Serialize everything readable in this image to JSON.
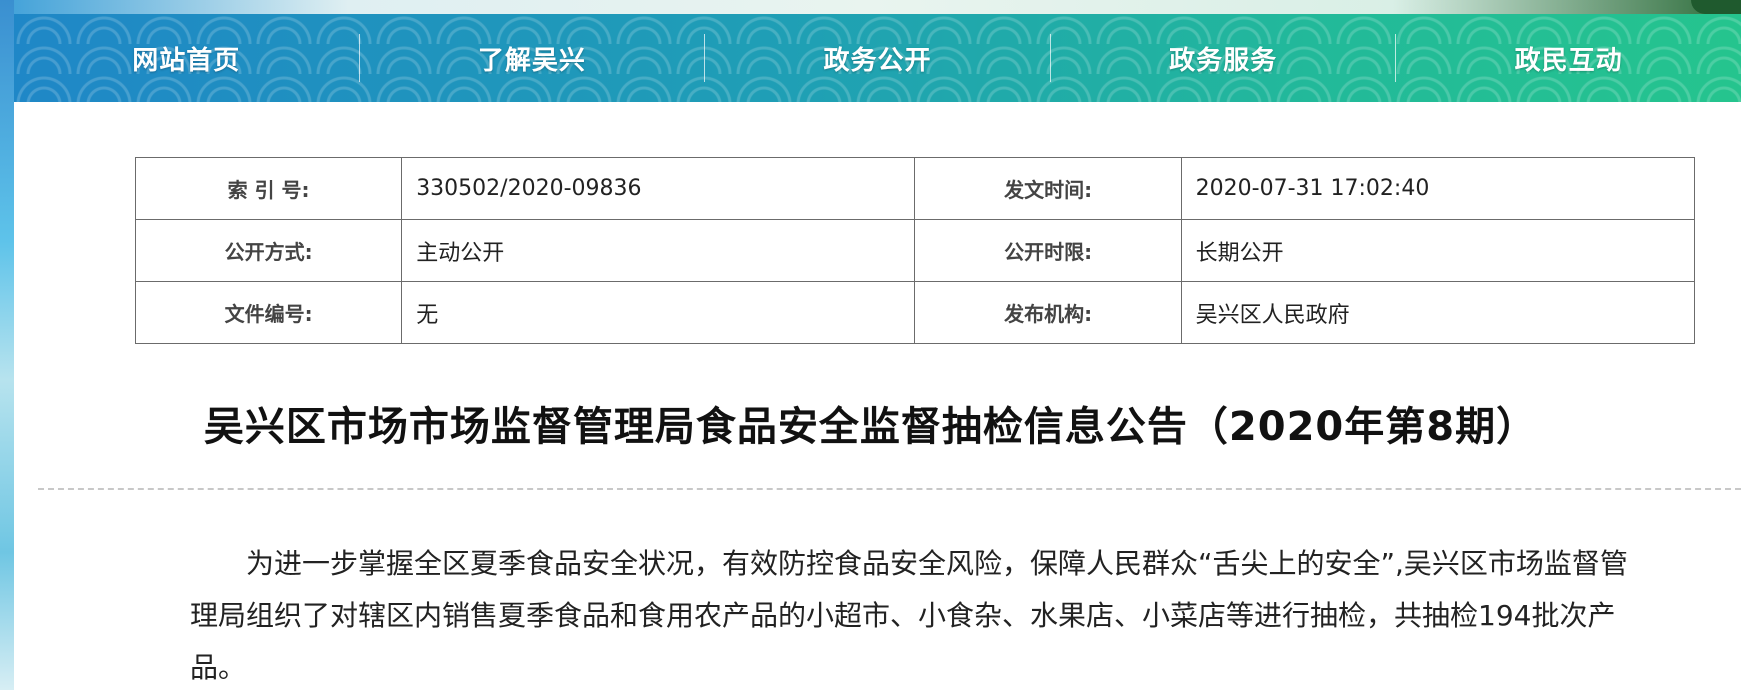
{
  "nav": {
    "items": [
      "网站首页",
      "了解吴兴",
      "政务公开",
      "政务服务",
      "政民互动"
    ]
  },
  "meta": {
    "rows": [
      {
        "k1": "索 引 号:",
        "v1": "330502/2020-09836",
        "k2": "发文时间:",
        "v2": "2020-07-31 17:02:40"
      },
      {
        "k1": "公开方式:",
        "v1": "主动公开",
        "k2": "公开时限:",
        "v2": "长期公开"
      },
      {
        "k1": "文件编号:",
        "v1": "无",
        "k2": "发布机构:",
        "v2": "吴兴区人民政府"
      }
    ]
  },
  "article": {
    "title": "吴兴区市场市场监督管理局食品安全监督抽检信息公告（2020年第8期）",
    "paragraph": "为进一步掌握全区夏季食品安全状况，有效防控食品安全风险，保障人民群众“舌尖上的安全”,吴兴区市场监督管理局组织了对辖区内销售夏季食品和食用农产品的小超市、小食杂、水果店、小菜店等进行抽检，共抽检194批次产品。"
  },
  "colors": {
    "nav_start": "#1f87c7",
    "nav_end": "#25c48e"
  }
}
